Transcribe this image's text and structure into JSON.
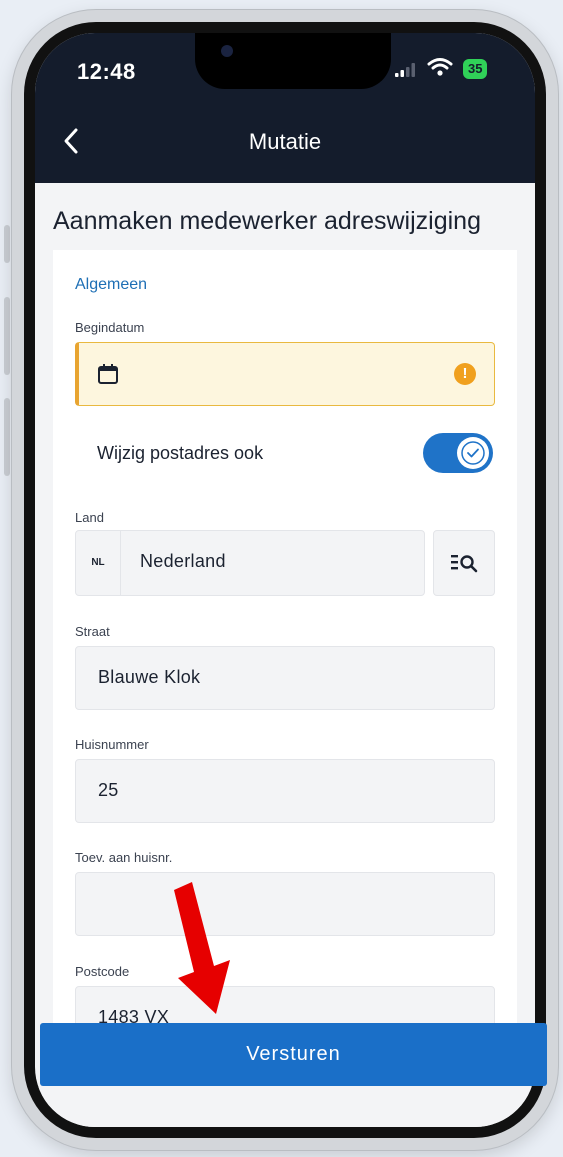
{
  "status_bar": {
    "time": "12:48",
    "battery": "35"
  },
  "nav": {
    "title": "Mutatie"
  },
  "page": {
    "heading": "Aanmaken medewerker adreswijziging"
  },
  "form": {
    "section_title": "Algemeen",
    "begindatum": {
      "label": "Begindatum",
      "value": ""
    },
    "postadres_toggle": {
      "label": "Wijzig postadres ook",
      "checked": true
    },
    "land": {
      "label": "Land",
      "code": "NL",
      "value": "Nederland"
    },
    "straat": {
      "label": "Straat",
      "value": "Blauwe Klok"
    },
    "huisnummer": {
      "label": "Huisnummer",
      "value": "25"
    },
    "toevoeging": {
      "label": "Toev. aan huisnr.",
      "value": ""
    },
    "postcode": {
      "label": "Postcode",
      "value": "1483 VX"
    }
  },
  "actions": {
    "submit_label": "Versturen"
  },
  "colors": {
    "nav_bg": "#141c2c",
    "primary": "#1a6fc8",
    "warning": "#f0a01e",
    "section_title": "#1e6fb5",
    "annotation_arrow": "#e60000"
  },
  "icons": [
    "back-chevron-icon",
    "calendar-icon",
    "warning-icon",
    "toggle-check-icon",
    "list-search-icon",
    "signal-icon",
    "wifi-icon",
    "battery-icon"
  ]
}
